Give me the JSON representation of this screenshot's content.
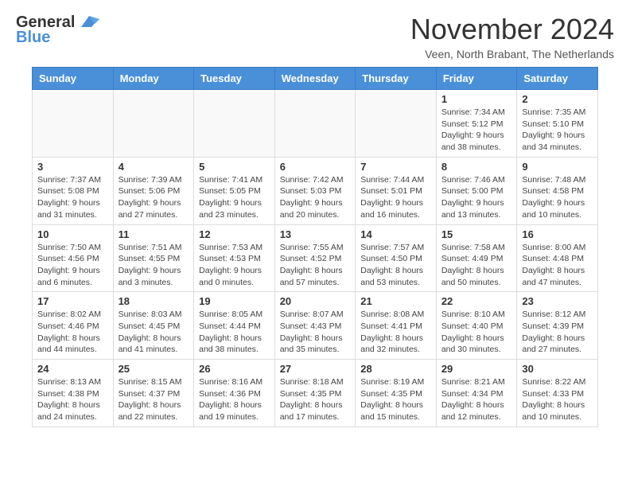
{
  "header": {
    "logo_line1": "General",
    "logo_line2": "Blue",
    "month_title": "November 2024",
    "location": "Veen, North Brabant, The Netherlands"
  },
  "days_of_week": [
    "Sunday",
    "Monday",
    "Tuesday",
    "Wednesday",
    "Thursday",
    "Friday",
    "Saturday"
  ],
  "weeks": [
    [
      {
        "day": "",
        "info": ""
      },
      {
        "day": "",
        "info": ""
      },
      {
        "day": "",
        "info": ""
      },
      {
        "day": "",
        "info": ""
      },
      {
        "day": "",
        "info": ""
      },
      {
        "day": "1",
        "info": "Sunrise: 7:34 AM\nSunset: 5:12 PM\nDaylight: 9 hours\nand 38 minutes."
      },
      {
        "day": "2",
        "info": "Sunrise: 7:35 AM\nSunset: 5:10 PM\nDaylight: 9 hours\nand 34 minutes."
      }
    ],
    [
      {
        "day": "3",
        "info": "Sunrise: 7:37 AM\nSunset: 5:08 PM\nDaylight: 9 hours\nand 31 minutes."
      },
      {
        "day": "4",
        "info": "Sunrise: 7:39 AM\nSunset: 5:06 PM\nDaylight: 9 hours\nand 27 minutes."
      },
      {
        "day": "5",
        "info": "Sunrise: 7:41 AM\nSunset: 5:05 PM\nDaylight: 9 hours\nand 23 minutes."
      },
      {
        "day": "6",
        "info": "Sunrise: 7:42 AM\nSunset: 5:03 PM\nDaylight: 9 hours\nand 20 minutes."
      },
      {
        "day": "7",
        "info": "Sunrise: 7:44 AM\nSunset: 5:01 PM\nDaylight: 9 hours\nand 16 minutes."
      },
      {
        "day": "8",
        "info": "Sunrise: 7:46 AM\nSunset: 5:00 PM\nDaylight: 9 hours\nand 13 minutes."
      },
      {
        "day": "9",
        "info": "Sunrise: 7:48 AM\nSunset: 4:58 PM\nDaylight: 9 hours\nand 10 minutes."
      }
    ],
    [
      {
        "day": "10",
        "info": "Sunrise: 7:50 AM\nSunset: 4:56 PM\nDaylight: 9 hours\nand 6 minutes."
      },
      {
        "day": "11",
        "info": "Sunrise: 7:51 AM\nSunset: 4:55 PM\nDaylight: 9 hours\nand 3 minutes."
      },
      {
        "day": "12",
        "info": "Sunrise: 7:53 AM\nSunset: 4:53 PM\nDaylight: 9 hours\nand 0 minutes."
      },
      {
        "day": "13",
        "info": "Sunrise: 7:55 AM\nSunset: 4:52 PM\nDaylight: 8 hours\nand 57 minutes."
      },
      {
        "day": "14",
        "info": "Sunrise: 7:57 AM\nSunset: 4:50 PM\nDaylight: 8 hours\nand 53 minutes."
      },
      {
        "day": "15",
        "info": "Sunrise: 7:58 AM\nSunset: 4:49 PM\nDaylight: 8 hours\nand 50 minutes."
      },
      {
        "day": "16",
        "info": "Sunrise: 8:00 AM\nSunset: 4:48 PM\nDaylight: 8 hours\nand 47 minutes."
      }
    ],
    [
      {
        "day": "17",
        "info": "Sunrise: 8:02 AM\nSunset: 4:46 PM\nDaylight: 8 hours\nand 44 minutes."
      },
      {
        "day": "18",
        "info": "Sunrise: 8:03 AM\nSunset: 4:45 PM\nDaylight: 8 hours\nand 41 minutes."
      },
      {
        "day": "19",
        "info": "Sunrise: 8:05 AM\nSunset: 4:44 PM\nDaylight: 8 hours\nand 38 minutes."
      },
      {
        "day": "20",
        "info": "Sunrise: 8:07 AM\nSunset: 4:43 PM\nDaylight: 8 hours\nand 35 minutes."
      },
      {
        "day": "21",
        "info": "Sunrise: 8:08 AM\nSunset: 4:41 PM\nDaylight: 8 hours\nand 32 minutes."
      },
      {
        "day": "22",
        "info": "Sunrise: 8:10 AM\nSunset: 4:40 PM\nDaylight: 8 hours\nand 30 minutes."
      },
      {
        "day": "23",
        "info": "Sunrise: 8:12 AM\nSunset: 4:39 PM\nDaylight: 8 hours\nand 27 minutes."
      }
    ],
    [
      {
        "day": "24",
        "info": "Sunrise: 8:13 AM\nSunset: 4:38 PM\nDaylight: 8 hours\nand 24 minutes."
      },
      {
        "day": "25",
        "info": "Sunrise: 8:15 AM\nSunset: 4:37 PM\nDaylight: 8 hours\nand 22 minutes."
      },
      {
        "day": "26",
        "info": "Sunrise: 8:16 AM\nSunset: 4:36 PM\nDaylight: 8 hours\nand 19 minutes."
      },
      {
        "day": "27",
        "info": "Sunrise: 8:18 AM\nSunset: 4:35 PM\nDaylight: 8 hours\nand 17 minutes."
      },
      {
        "day": "28",
        "info": "Sunrise: 8:19 AM\nSunset: 4:35 PM\nDaylight: 8 hours\nand 15 minutes."
      },
      {
        "day": "29",
        "info": "Sunrise: 8:21 AM\nSunset: 4:34 PM\nDaylight: 8 hours\nand 12 minutes."
      },
      {
        "day": "30",
        "info": "Sunrise: 8:22 AM\nSunset: 4:33 PM\nDaylight: 8 hours\nand 10 minutes."
      }
    ]
  ]
}
